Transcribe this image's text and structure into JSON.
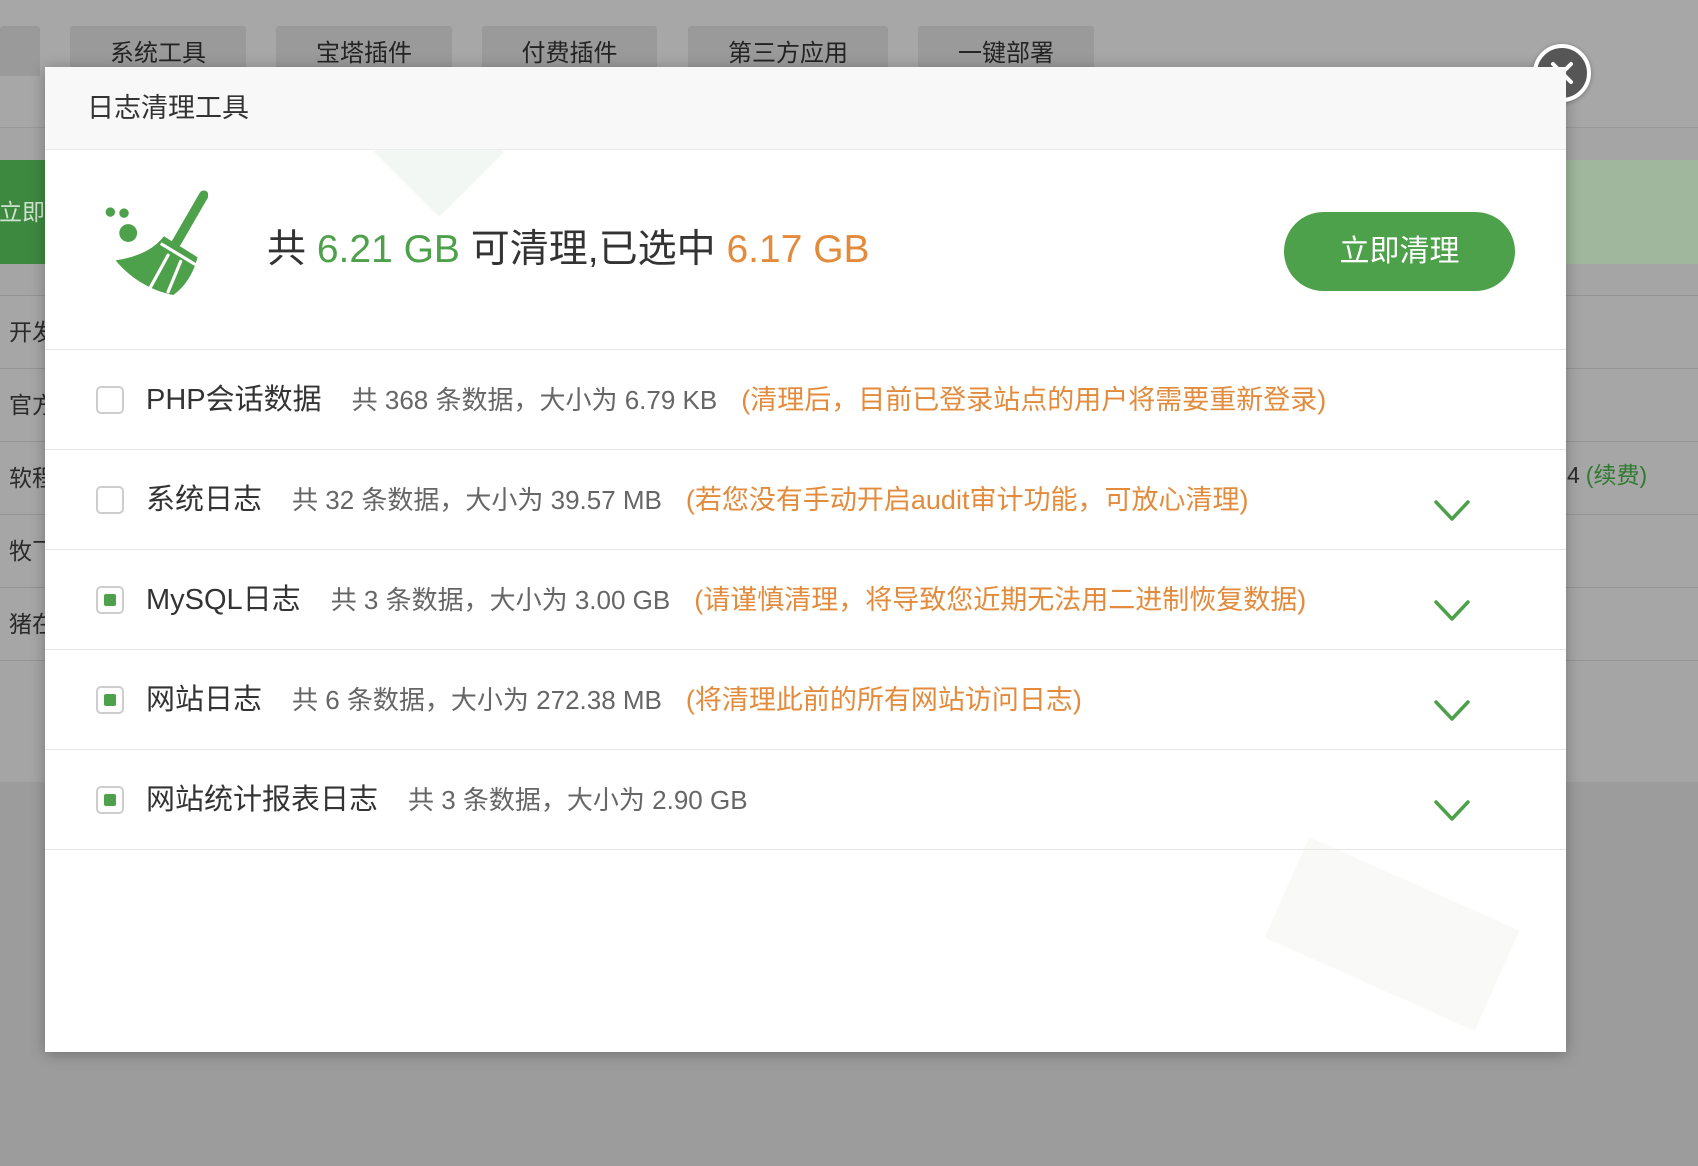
{
  "background": {
    "tabs": [
      {
        "label": "系统工具"
      },
      {
        "label": "宝塔插件"
      },
      {
        "label": "付费插件"
      },
      {
        "label": "第三方应用"
      },
      {
        "label": "一键部署"
      }
    ],
    "notice_button": "立即",
    "table_rows": [
      "开发",
      "官方",
      "软程",
      "牧飞",
      "猪在"
    ],
    "right_cell": {
      "text": "4",
      "link": "(续费)"
    }
  },
  "modal": {
    "title": "日志清理工具",
    "summary": {
      "prefix": "共",
      "total": "6.21 GB",
      "middle": "可清理,已选中",
      "selected": "6.17 GB"
    },
    "clean_button": "立即清理",
    "items": [
      {
        "name": "PHP会话数据",
        "info": "共 368 条数据，大小为 6.79 KB",
        "note": "(清理后，目前已登录站点的用户将需要重新登录)",
        "checked": false,
        "expandable": false
      },
      {
        "name": "系统日志",
        "info": "共 32 条数据，大小为 39.57 MB",
        "note": "(若您没有手动开启audit审计功能，可放心清理)",
        "checked": false,
        "expandable": true
      },
      {
        "name": "MySQL日志",
        "info": "共 3 条数据，大小为 3.00 GB",
        "note": "(请谨慎清理，将导致您近期无法用二进制恢复数据)",
        "checked": true,
        "expandable": true
      },
      {
        "name": "网站日志",
        "info": "共 6 条数据，大小为 272.38 MB",
        "note": "(将清理此前的所有网站访问日志)",
        "checked": true,
        "expandable": true
      },
      {
        "name": "网站统计报表日志",
        "info": "共 3 条数据，大小为 2.90 GB",
        "note": "",
        "checked": true,
        "expandable": true
      }
    ]
  },
  "icons": {
    "broom": "broom-icon",
    "chevron": "chevron-down-icon",
    "close": "close-icon"
  },
  "colors": {
    "green": "#4ea14b",
    "orange": "#e38b3c"
  }
}
